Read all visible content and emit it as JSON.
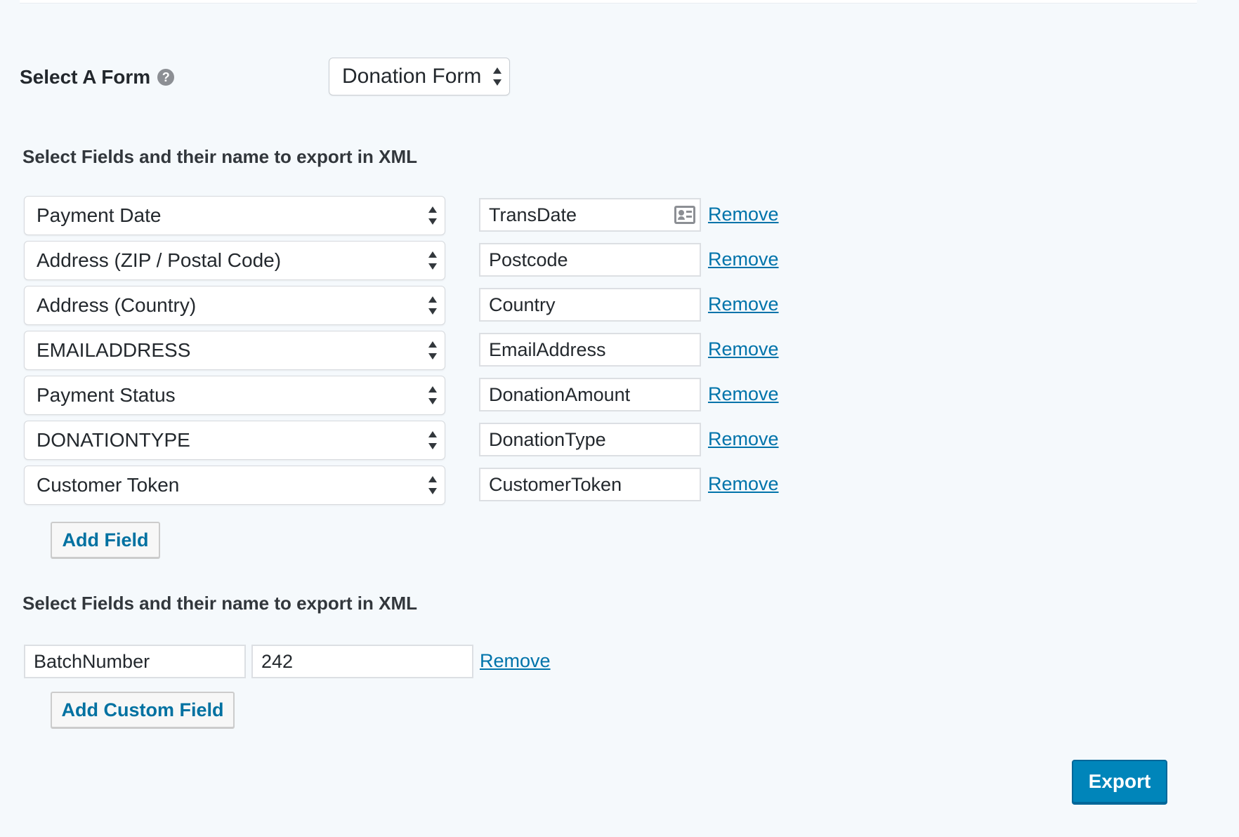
{
  "form_selector": {
    "label": "Select A Form",
    "help_glyph": "?",
    "selected": "Donation Form"
  },
  "fields_section": {
    "heading": "Select Fields and their name to export in XML",
    "rows": [
      {
        "field": "Payment Date",
        "name": "TransDate",
        "remove": "Remove"
      },
      {
        "field": "Address (ZIP / Postal Code)",
        "name": "Postcode",
        "remove": "Remove"
      },
      {
        "field": "Address (Country)",
        "name": "Country",
        "remove": "Remove"
      },
      {
        "field": "EMAILADDRESS",
        "name": "EmailAddress",
        "remove": "Remove"
      },
      {
        "field": "Payment Status",
        "name": "DonationAmount",
        "remove": "Remove"
      },
      {
        "field": "DONATIONTYPE",
        "name": "DonationType",
        "remove": "Remove"
      },
      {
        "field": "Customer Token",
        "name": "CustomerToken",
        "remove": "Remove"
      }
    ],
    "add_button": "Add Field"
  },
  "custom_section": {
    "heading": "Select Fields and their name to export in XML",
    "rows": [
      {
        "name": "BatchNumber",
        "value": "242",
        "remove": "Remove"
      }
    ],
    "add_button": "Add Custom Field"
  },
  "export_button": "Export",
  "colors": {
    "page_background": "#f5f9fc",
    "link": "#0073aa",
    "primary_button": "#0085ba",
    "secondary_button_text": "#0071a1"
  },
  "icons": {
    "help": "help-icon",
    "select_arrows": "select-arrows-icon",
    "autofill": "contact-card-icon"
  }
}
